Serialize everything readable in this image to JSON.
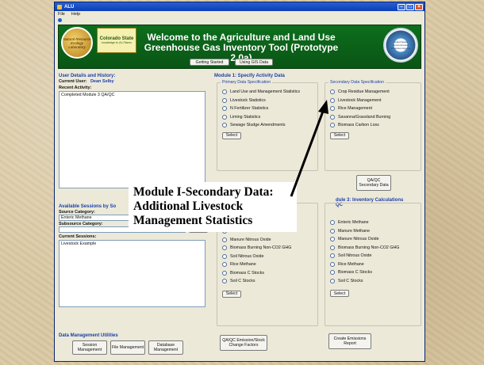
{
  "window": {
    "title": "ALU",
    "menu": [
      "File",
      "Help"
    ]
  },
  "banner": {
    "title_line1": "Welcome to the Agriculture and Land Use",
    "title_line2": "Greenhouse Gas Inventory Tool (Prototype 2.0a)",
    "getting_started": "Getting Started",
    "using_gis": "Using GIS Data",
    "csu_name": "Colorado State",
    "csu_tagline": "knowledge to Go Places",
    "nrel_label": "Natural Resource Ecology Laboratory",
    "epa_label": "United States Environmental Protection Agency"
  },
  "user": {
    "section_title": "User Details and History:",
    "current_user_label": "Current User:",
    "current_user_value": "Dean Selby",
    "recent_activity_label": "Recent Activity:",
    "recent_activity_value": "Completed Module 3 QA/QC"
  },
  "sessions": {
    "section_title": "Available Sessions by So",
    "source_category_label": "Source Category:",
    "source_category_value": "Enteric Methane",
    "subsource_category_label": "Subsource Category:",
    "current_sessions_label": "Current Sessions:",
    "current_sessions_value": "Livestock Example"
  },
  "data_mgmt": {
    "section_title": "Data Management Utilities",
    "buttons": [
      "Session Management",
      "File Management",
      "Database Management"
    ]
  },
  "module1": {
    "section_title": "Module 1: Specify Activity Data",
    "primary_legend": "Primary Data Specification",
    "primary_items": [
      "Land Use and Management Statistics",
      "Livestock Statistics",
      "N Fertilizer Statistics",
      "Liming Statistics",
      "Sewage Sludge Amendments"
    ],
    "secondary_legend": "Secondary Data Specification",
    "secondary_items": [
      "Crop Residue Management",
      "Livestock Management",
      "Rice Management",
      "Savanna/Grassland Burning",
      "Biomass Carbon Loss"
    ],
    "select_label": "Select",
    "qaqc_secondary": "QA/QC Secondary Data"
  },
  "module2": {
    "items": [
      "Manure Methane",
      "Manure Nitrous Oxide",
      "Biomass Burning Non-CO2 GHG",
      "Soil Nitrous Oxide",
      "Rice Methane",
      "Biomass C Stocks",
      "Soil C Stocks"
    ],
    "select_label": "Select",
    "qaqc_emission": "QA/QC Emission/Stock Change Factors"
  },
  "module3": {
    "section_title": "dule 3: Inventory Calculations",
    "qaqc_suffix": "QC",
    "first_item": "Enteric Methane",
    "items": [
      "Manure Methane",
      "Manure Nitrous Oxide",
      "Biomass Burning Non-CO2 GHG",
      "Soil Nitrous Oxide",
      "Rice Methane",
      "Biomass C Stocks",
      "Soil C Stocks"
    ],
    "select_label": "Select",
    "create_report": "Create Emissions Report"
  },
  "annotation": {
    "line1": "Module I-Secondary Data:",
    "line2": "Additional Livestock",
    "line3": "Management Statistics"
  }
}
